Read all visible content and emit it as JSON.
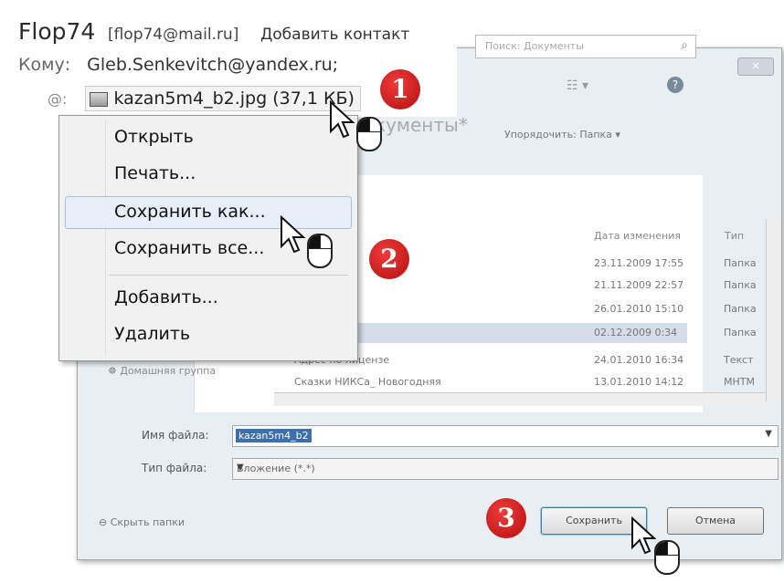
{
  "mail": {
    "sender_name": "Flop74",
    "sender_email": "[flop74@mail.ru]",
    "add_contact": "Добавить контакт",
    "to_label": "Кому:",
    "to_value": "Gleb.Senkevitch@yandex.ru;",
    "attachment": "kazan5m4_b2.jpg (37,1 КБ)"
  },
  "context_menu": {
    "items": [
      "Открыть",
      "Печать...",
      "Сохранить как...",
      "Сохранить все...",
      "Добавить...",
      "Удалить"
    ]
  },
  "dialog": {
    "search_placeholder": "Поиск: Документы",
    "library_title": "кументы*",
    "arrange_label": "Упорядочить:",
    "arrange_value": "Папка ▾",
    "columns": {
      "date": "Дата изменения",
      "type": "Тип"
    },
    "rows": [
      {
        "name": "",
        "date": "23.11.2009 17:55",
        "type": "Папка"
      },
      {
        "name": "",
        "date": "21.11.2009 22:57",
        "type": "Папка"
      },
      {
        "name": "",
        "date": "26.01.2010 15:10",
        "type": "Папка"
      },
      {
        "name": "",
        "date": "02.12.2009 0:34",
        "type": "Папка"
      },
      {
        "name": "Адрес по лицензе",
        "date": "24.01.2010 16:34",
        "type": "Текст"
      },
      {
        "name": "Сказки НИКСа_ Новогодняя",
        "date": "13.01.2010 14:12",
        "type": "MHTM"
      }
    ],
    "sidebar_home": "Домашняя группа",
    "filename_label": "Имя файла:",
    "filename_value": "kazan5m4_b2",
    "filetype_label": "Тип файла:",
    "filetype_value": "Вложение (*.*)",
    "hide_folders": "Скрыть папки",
    "save_button": "Сохранить",
    "cancel_button": "Отмена"
  },
  "steps": [
    "1",
    "2",
    "3"
  ],
  "colors": {
    "badge": "#c61414",
    "selection": "#3b6fb0",
    "menu_highlight": "#e6eef8"
  }
}
